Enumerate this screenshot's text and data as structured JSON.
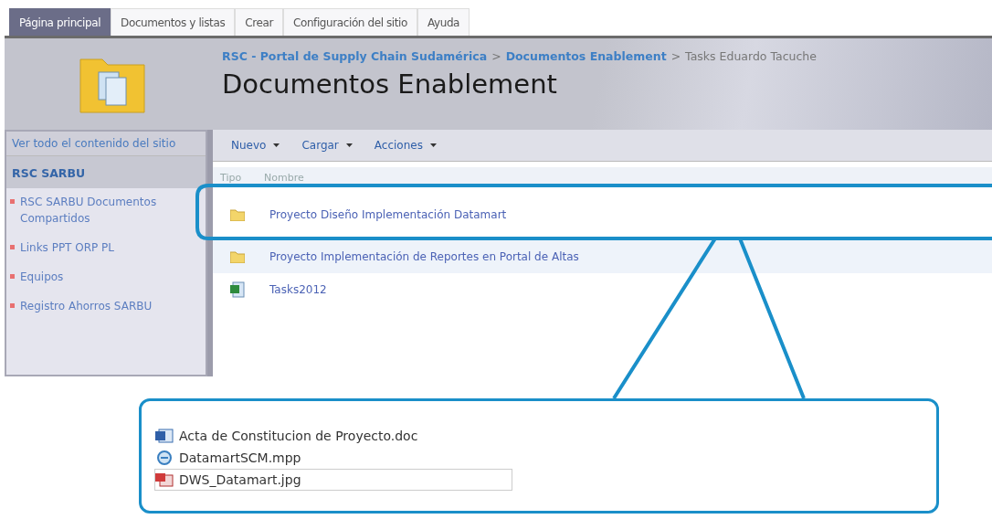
{
  "top_nav": [
    {
      "label": "Página principal",
      "selected": true
    },
    {
      "label": "Documentos y listas",
      "selected": false
    },
    {
      "label": "Crear",
      "selected": false
    },
    {
      "label": "Configuración del sitio",
      "selected": false
    },
    {
      "label": "Ayuda",
      "selected": false
    }
  ],
  "breadcrumb": [
    {
      "label": "RSC - Portal de Supply Chain Sudamérica",
      "kind": "link"
    },
    {
      "label": ">",
      "kind": "sep"
    },
    {
      "label": "Documentos Enablement",
      "kind": "link"
    },
    {
      "label": ">",
      "kind": "sep"
    },
    {
      "label": "Tasks Eduardo Tacuche",
      "kind": "current"
    }
  ],
  "page_title": "Documentos Enablement",
  "sidebar": {
    "view_all": "Ver todo el contenido del sitio",
    "section": "RSC SARBU",
    "items": [
      "RSC SARBU Documentos Compartidos",
      "Links PPT ORP PL",
      "Equipos",
      "Registro Ahorros SARBU"
    ]
  },
  "toolbar": [
    {
      "label": "Nuevo"
    },
    {
      "label": "Cargar"
    },
    {
      "label": "Acciones"
    }
  ],
  "table": {
    "columns": [
      "Tipo",
      "Nombre"
    ],
    "rows": [
      {
        "kind": "folder",
        "name": "Proyecto Diseño Implementación Datamart"
      },
      {
        "kind": "folder",
        "name": "Proyecto Implementación de Reportes en Portal de Altas"
      },
      {
        "kind": "spreadsheet",
        "name": "Tasks2012"
      }
    ]
  },
  "callout_files": [
    {
      "kind": "doc",
      "name": "Acta de Constitucion de Proyecto.doc",
      "selected": false
    },
    {
      "kind": "project",
      "name": "DatamartSCM.mpp",
      "selected": false
    },
    {
      "kind": "image",
      "name": "DWS_Datamart.jpg",
      "selected": true
    }
  ]
}
